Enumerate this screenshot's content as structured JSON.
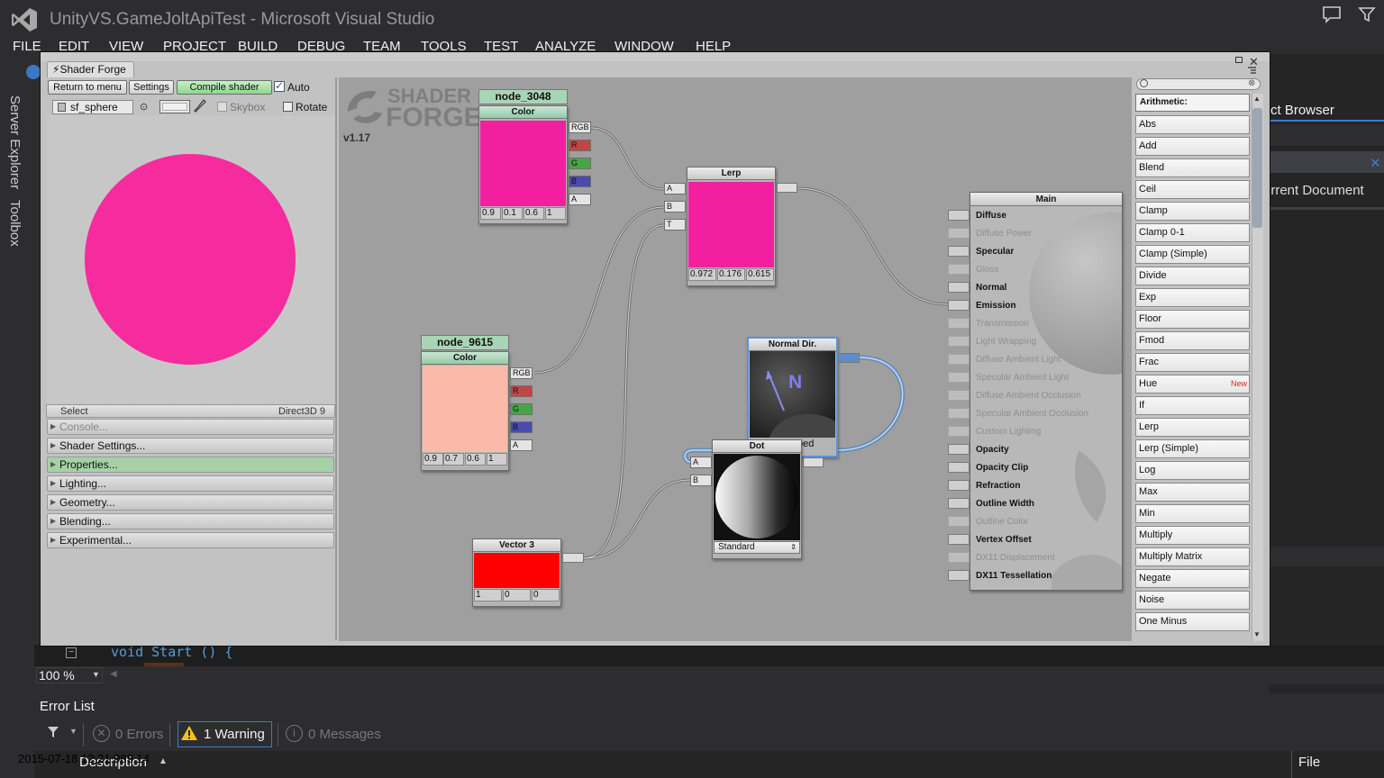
{
  "window": {
    "title": "UnityVS.GameJoltApiTest - Microsoft Visual Studio"
  },
  "menubar": [
    "FILE",
    "EDIT",
    "VIEW",
    "PROJECT",
    "BUILD",
    "DEBUG",
    "TEAM",
    "TOOLS",
    "TEST",
    "ANALYZE",
    "WINDOW",
    "HELP"
  ],
  "side_tabs": [
    "Server Explorer",
    "Toolbox"
  ],
  "right_panel": {
    "title": "ct Browser",
    "current_doc": "urrent Document",
    "close": "✕"
  },
  "code": {
    "line": "void Start () {"
  },
  "editor": {
    "zoom": "100 %"
  },
  "error_list": {
    "title": "Error List",
    "errors": "0 Errors",
    "warnings": "1 Warning",
    "messages": "0 Messages",
    "col_description": "Description",
    "col_file": "File",
    "timestamp": "2015-07-18 12:21:989.14"
  },
  "shader_forge": {
    "tab": "Shader Forge",
    "buttons": {
      "return": "Return to menu",
      "settings": "Settings",
      "compile": "Compile shader",
      "auto": "Auto"
    },
    "preview": {
      "mesh": "sf_sphere",
      "skybox": "Skybox",
      "rotate": "Rotate",
      "sphere_color": "#f52b9e"
    },
    "select": {
      "label": "Select",
      "renderer": "Direct3D 9"
    },
    "panels": [
      {
        "label": "Console...",
        "state": "dim"
      },
      {
        "label": "Shader Settings...",
        "state": "normal"
      },
      {
        "label": "Properties...",
        "state": "selected"
      },
      {
        "label": "Lighting...",
        "state": "normal"
      },
      {
        "label": "Geometry...",
        "state": "normal"
      },
      {
        "label": "Blending...",
        "state": "normal"
      },
      {
        "label": "Experimental...",
        "state": "normal"
      }
    ],
    "logo": {
      "line1": "SHADER",
      "line2": "FORGE",
      "version": "v1.17"
    },
    "nodes": {
      "color1": {
        "name": "node_3048",
        "type": "Color",
        "swatch": "#f21f9e",
        "values": [
          "0.9",
          "0.1",
          "0.6",
          "1"
        ],
        "ports": [
          "RGB",
          "R",
          "G",
          "B",
          "A"
        ]
      },
      "color2": {
        "name": "node_9615",
        "type": "Color",
        "swatch": "#fbbaa9",
        "values": [
          "0.9",
          "0.7",
          "0.6",
          "1"
        ],
        "ports": [
          "RGB",
          "R",
          "G",
          "B",
          "A"
        ]
      },
      "lerp": {
        "title": "Lerp",
        "swatch": "#f21f9e",
        "values": [
          "0.972",
          "0.176",
          "0.615"
        ],
        "inputs": [
          "A",
          "B",
          "T"
        ]
      },
      "normal": {
        "title": "Normal Dir.",
        "label": "N",
        "footer": "ped"
      },
      "dot": {
        "title": "Dot",
        "inputs": [
          "A",
          "B"
        ],
        "mode": "Standard"
      },
      "vector3": {
        "title": "Vector 3",
        "swatch": "#ff0000",
        "values": [
          "1",
          "0",
          "0"
        ]
      }
    },
    "main": {
      "title": "Main",
      "inputs": [
        {
          "label": "Diffuse",
          "active": true
        },
        {
          "label": "Diffuse Power",
          "active": false
        },
        {
          "label": "Specular",
          "active": true
        },
        {
          "label": "Gloss",
          "active": false
        },
        {
          "label": "Normal",
          "active": true
        },
        {
          "label": "Emission",
          "active": true
        },
        {
          "label": "Transmission",
          "active": false
        },
        {
          "label": "Light Wrapping",
          "active": false
        },
        {
          "label": "Diffuse Ambient Light",
          "active": false
        },
        {
          "label": "Specular Ambient Light",
          "active": false
        },
        {
          "label": "Diffuse Ambient Occlusion",
          "active": false
        },
        {
          "label": "Specular Ambient Occlusion",
          "active": false
        },
        {
          "label": "Custom Lighting",
          "active": false
        },
        {
          "label": "Opacity",
          "active": true
        },
        {
          "label": "Opacity Clip",
          "active": true
        },
        {
          "label": "Refraction",
          "active": true
        },
        {
          "label": "Outline Width",
          "active": true
        },
        {
          "label": "Outline Color",
          "active": false
        },
        {
          "label": "Vertex Offset",
          "active": true
        },
        {
          "label": "DX11 Displacement",
          "active": false
        },
        {
          "label": "DX11 Tessellation",
          "active": true
        }
      ]
    },
    "node_list": {
      "category": "Arithmetic:",
      "new_badge": "New",
      "items": [
        "Abs",
        "Add",
        "Blend",
        "Ceil",
        "Clamp",
        "Clamp 0-1",
        "Clamp (Simple)",
        "Divide",
        "Exp",
        "Floor",
        "Fmod",
        "Frac",
        "Hue",
        "If",
        "Lerp",
        "Lerp (Simple)",
        "Log",
        "Max",
        "Min",
        "Multiply",
        "Multiply Matrix",
        "Negate",
        "Noise",
        "One Minus"
      ]
    }
  }
}
